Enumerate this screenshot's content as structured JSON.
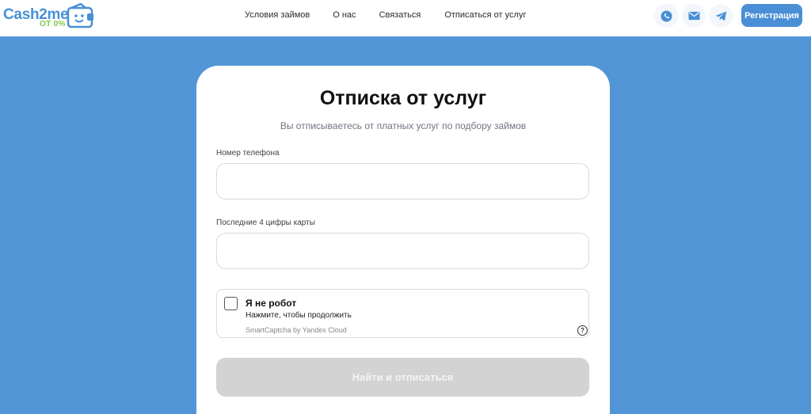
{
  "header": {
    "logo": {
      "name": "Cash2me",
      "sub": "ОТ 0%"
    },
    "nav": [
      {
        "label": "Условия займов"
      },
      {
        "label": "О нас"
      },
      {
        "label": "Связаться"
      },
      {
        "label": "Отписаться от услуг"
      }
    ],
    "icons": [
      "phone-icon",
      "mail-icon",
      "telegram-icon"
    ],
    "register_label": "Регистрация"
  },
  "form": {
    "title": "Отписка от услуг",
    "subtitle": "Вы отписываетесь от платных услуг по подбору займов",
    "phone_label": "Номер телефона",
    "phone_value": "",
    "card_label": "Последние 4 цифры карты",
    "card_value": "",
    "captcha": {
      "title": "Я не робот",
      "hint": "Нажмите, чтобы продолжить",
      "brand": "SmartCaptcha by Yandex Cloud",
      "help": "?"
    },
    "submit_label": "Найти и отписаться"
  },
  "colors": {
    "background": "#5295d6",
    "brand": "#4a8fd6",
    "accent_green": "#7fc54a",
    "disabled_button": "#d3d3d3"
  }
}
